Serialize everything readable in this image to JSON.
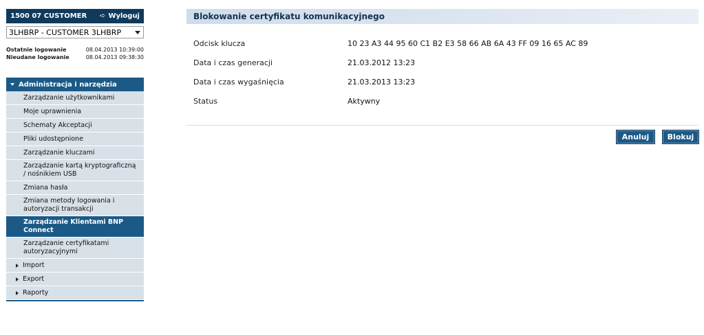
{
  "header": {
    "account_label": "1500 07 CUSTOMER",
    "logout_label": "Wyloguj"
  },
  "client_select": {
    "selected": "3LHBRP - CUSTOMER 3LHBRP"
  },
  "login_info": {
    "last_login_label": "Ostatnie logowanie",
    "last_login_value": "08.04.2013 10:39:00",
    "failed_login_label": "Nieudane logowanie",
    "failed_login_value": "08.04.2013 09:38:30"
  },
  "menu": {
    "section_title": "Administracja i narzędzia",
    "items": [
      {
        "label": "Zarządzanie użytkownikami"
      },
      {
        "label": "Moje uprawnienia"
      },
      {
        "label": "Schematy Akceptacji"
      },
      {
        "label": "Pliki udostępnione"
      },
      {
        "label": "Zarządzanie kluczami"
      },
      {
        "label": "Zarządzanie kartą kryptograficzną / nośnikiem USB"
      },
      {
        "label": "Zmiana hasła"
      },
      {
        "label": "Zmiana metody logowania i autoryzacji transakcji"
      },
      {
        "label": "Zarządzanie Klientami BNP Connect"
      },
      {
        "label": "Zarządzanie certyfikatami autoryzacyjnymi"
      }
    ],
    "sections": [
      {
        "label": "Import"
      },
      {
        "label": "Export"
      },
      {
        "label": "Raporty"
      }
    ]
  },
  "main": {
    "title": "Blokowanie certyfikatu komunikacyjnego",
    "fields": [
      {
        "label": "Odcisk klucza",
        "value": "10 23 A3 44 95 60 C1 B2 E3 58 66 AB 6A 43 FF 09 16 65 AC 89"
      },
      {
        "label": "Data i czas generacji",
        "value": "21.03.2012 13:23"
      },
      {
        "label": "Data i czas wygaśnięcia",
        "value": "21.03.2013 13:23"
      },
      {
        "label": "Status",
        "value": "Aktywny"
      }
    ],
    "cancel_label": "Anuluj",
    "block_label": "Blokuj"
  },
  "colors": {
    "header_navy": "#0f3a5c",
    "accent_blue": "#1b5a87",
    "menu_bg": "#d8e0e8",
    "title_bar_bg": "#cfdced"
  }
}
